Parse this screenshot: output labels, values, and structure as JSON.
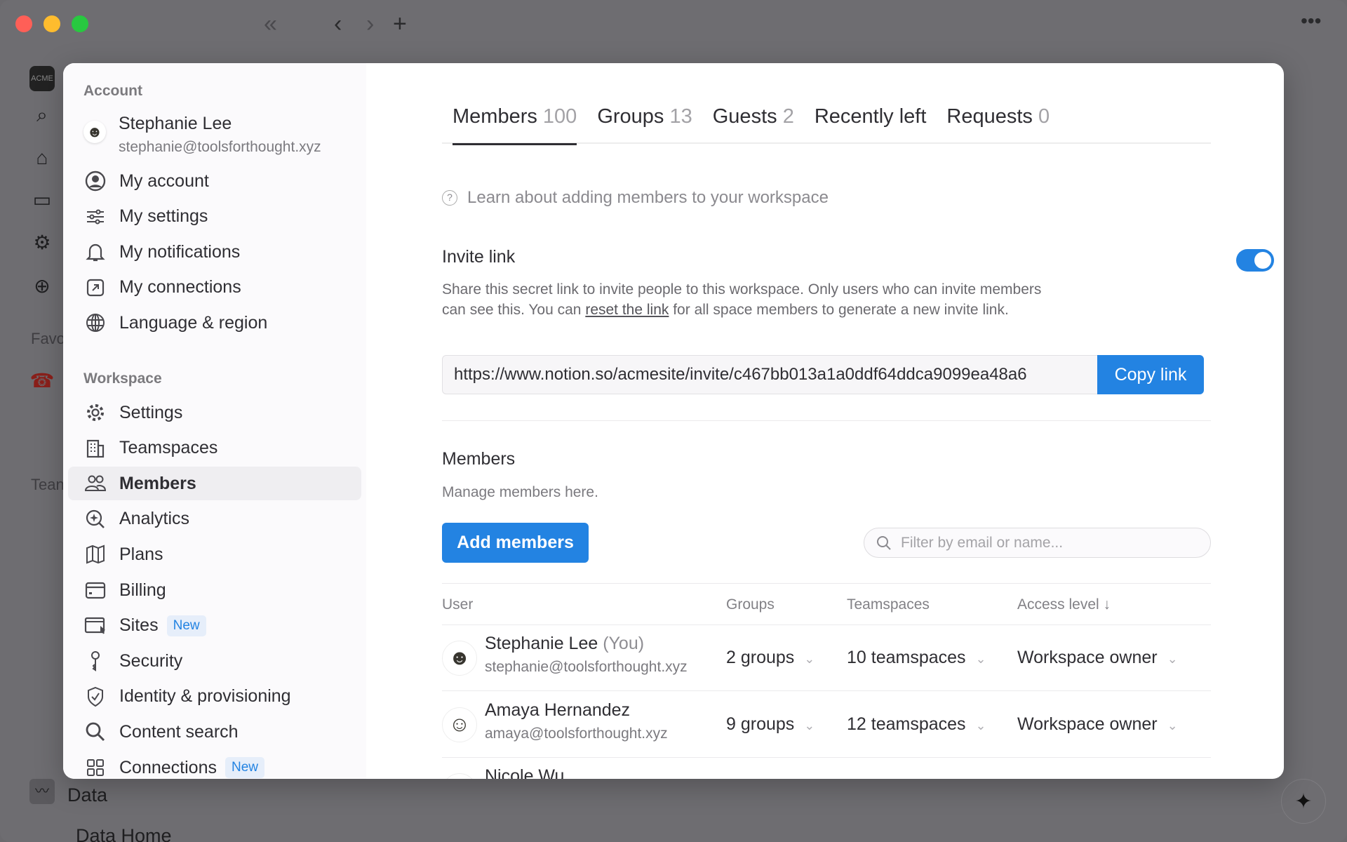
{
  "window": {
    "traffic_colors": [
      "#ff5f57",
      "#febc2e",
      "#28c840"
    ]
  },
  "background_sidebar": {
    "labels": {
      "favorites": "Favo",
      "teamspaces": "Tean",
      "data": "Data",
      "data_home": "Data Home"
    },
    "logo": "ACME"
  },
  "sidebar": {
    "account_section": "Account",
    "user": {
      "name": "Stephanie Lee",
      "email": "stephanie@toolsforthought.xyz"
    },
    "account_items": [
      {
        "label": "My account",
        "icon": "user-circle-icon"
      },
      {
        "label": "My settings",
        "icon": "sliders-icon"
      },
      {
        "label": "My notifications",
        "icon": "bell-icon"
      },
      {
        "label": "My connections",
        "icon": "external-link-icon"
      },
      {
        "label": "Language & region",
        "icon": "globe-icon"
      }
    ],
    "workspace_section": "Workspace",
    "workspace_items": [
      {
        "label": "Settings",
        "icon": "gear-icon"
      },
      {
        "label": "Teamspaces",
        "icon": "building-icon"
      },
      {
        "label": "Members",
        "icon": "people-icon",
        "active": true
      },
      {
        "label": "Analytics",
        "icon": "analytics-icon"
      },
      {
        "label": "Plans",
        "icon": "map-icon"
      },
      {
        "label": "Billing",
        "icon": "credit-card-icon"
      },
      {
        "label": "Sites",
        "icon": "browser-cursor-icon",
        "badge": "New"
      },
      {
        "label": "Security",
        "icon": "key-icon"
      },
      {
        "label": "Identity & provisioning",
        "icon": "shield-check-icon"
      },
      {
        "label": "Content search",
        "icon": "search-icon"
      },
      {
        "label": "Connections",
        "icon": "grid-icon",
        "badge": "New"
      }
    ]
  },
  "tabs": [
    {
      "label": "Members",
      "count": "100",
      "active": true
    },
    {
      "label": "Groups",
      "count": "13"
    },
    {
      "label": "Guests",
      "count": "2"
    },
    {
      "label": "Recently left",
      "count": ""
    },
    {
      "label": "Requests",
      "count": "0"
    }
  ],
  "learn_link": "Learn about adding members to your workspace",
  "invite": {
    "title": "Invite link",
    "enabled": true,
    "desc_before": "Share this secret link to invite people to this workspace. Only users who can invite members can see this. You can ",
    "desc_link": "reset the link",
    "desc_after": " for all space members to generate a new invite link.",
    "url": "https://www.notion.so/acmesite/invite/c467bb013a1a0ddf64ddca9099ea48a6",
    "copy_label": "Copy link"
  },
  "members": {
    "title": "Members",
    "subtitle": "Manage members here.",
    "add_label": "Add members",
    "filter_placeholder": "Filter by email or name...",
    "columns": {
      "user": "User",
      "groups": "Groups",
      "teamspaces": "Teamspaces",
      "access": "Access level ↓"
    },
    "rows": [
      {
        "name": "Stephanie Lee",
        "you": "(You)",
        "email": "stephanie@toolsforthought.xyz",
        "groups": "2 groups",
        "teamspaces": "10 teamspaces",
        "access": "Workspace owner"
      },
      {
        "name": "Amaya Hernandez",
        "you": "",
        "email": "amaya@toolsforthought.xyz",
        "groups": "9 groups",
        "teamspaces": "12 teamspaces",
        "access": "Workspace owner"
      },
      {
        "name": "Nicole Wu",
        "you": "",
        "email": "",
        "groups": "",
        "teamspaces": "",
        "access": ""
      }
    ]
  },
  "colors": {
    "accent": "#2383e2"
  }
}
